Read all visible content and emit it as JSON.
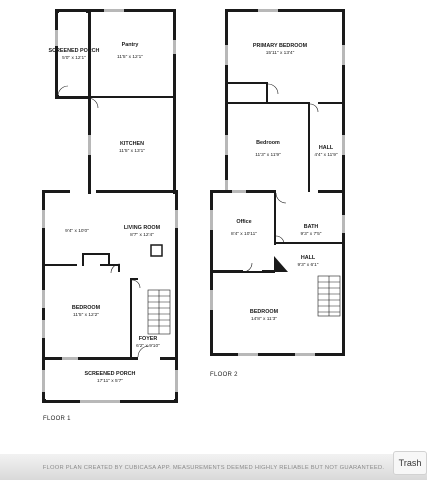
{
  "floors": [
    {
      "label": "FLOOR 1",
      "rooms": [
        {
          "name": "SCREENED PORCH",
          "dims": "5'0\" x 12'1\""
        },
        {
          "name": "Pantry",
          "dims": "11'5\" x 12'1\""
        },
        {
          "name": "KITCHEN",
          "dims": "11'5\" x 13'1\""
        },
        {
          "name": "",
          "dims": "9'4\" x 10'0\""
        },
        {
          "name": "LIVING ROOM",
          "dims": "8'7\" x 12'4\""
        },
        {
          "name": "BEDROOM",
          "dims": "11'5\" x 12'2\""
        },
        {
          "name": "FOYER",
          "dims": "6'2\" x 9'10\""
        },
        {
          "name": "SCREENED PORCH",
          "dims": "17'11\" x 5'7\""
        }
      ]
    },
    {
      "label": "FLOOR 2",
      "rooms": [
        {
          "name": "PRIMARY BEDROOM",
          "dims": "15'11\" x 13'4\""
        },
        {
          "name": "Bedroom",
          "dims": "11'3\" x 11'9\""
        },
        {
          "name": "HALL",
          "dims": "4'4\" x 11'9\""
        },
        {
          "name": "Office",
          "dims": "8'4\" x 10'11\""
        },
        {
          "name": "BATH",
          "dims": "9'3\" x 7'5\""
        },
        {
          "name": "HALL",
          "dims": "9'3\" x 6'1\""
        },
        {
          "name": "BEDROOM",
          "dims": "14'8\" x 11'3\""
        }
      ]
    }
  ],
  "footer": {
    "disclaimer": "FLOOR PLAN CREATED BY CUBICASA APP. MEASUREMENTS DEEMED HIGHLY RELIABLE BUT NOT GUARANTEED."
  },
  "trash_button": {
    "label": "Trash"
  },
  "colors": {
    "wall": "#1a1a1a",
    "window": "#b8b8b8",
    "background": "#ffffff"
  }
}
